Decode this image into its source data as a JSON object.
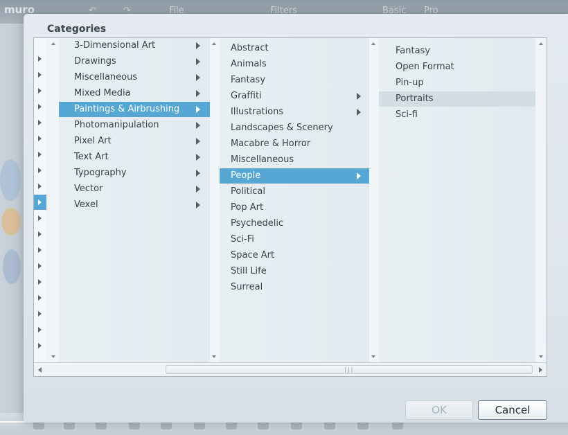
{
  "app": {
    "logo": "muro",
    "toolbar": [
      "File",
      "Filters",
      "Basic",
      "Pro"
    ]
  },
  "dialog": {
    "title": "Categories",
    "ok_label": "OK",
    "cancel_label": "Cancel"
  },
  "columns": {
    "col1": [
      {
        "label": "3-Dimensional Art",
        "has_children": true
      },
      {
        "label": "Drawings",
        "has_children": true
      },
      {
        "label": "Miscellaneous",
        "has_children": true
      },
      {
        "label": "Mixed Media",
        "has_children": true
      },
      {
        "label": "Paintings & Airbrushing",
        "has_children": true,
        "selected": true
      },
      {
        "label": "Photomanipulation",
        "has_children": true
      },
      {
        "label": "Pixel Art",
        "has_children": true
      },
      {
        "label": "Text Art",
        "has_children": true
      },
      {
        "label": "Typography",
        "has_children": true
      },
      {
        "label": "Vector",
        "has_children": true
      },
      {
        "label": "Vexel",
        "has_children": true
      }
    ],
    "col2": [
      {
        "label": "Abstract",
        "has_children": false
      },
      {
        "label": "Animals",
        "has_children": false
      },
      {
        "label": "Fantasy",
        "has_children": false
      },
      {
        "label": "Graffiti",
        "has_children": true
      },
      {
        "label": "Illustrations",
        "has_children": true
      },
      {
        "label": "Landscapes & Scenery",
        "has_children": false
      },
      {
        "label": "Macabre & Horror",
        "has_children": false
      },
      {
        "label": "Miscellaneous",
        "has_children": false
      },
      {
        "label": "People",
        "has_children": true,
        "selected": true
      },
      {
        "label": "Political",
        "has_children": false
      },
      {
        "label": "Pop Art",
        "has_children": false
      },
      {
        "label": "Psychedelic",
        "has_children": false
      },
      {
        "label": "Sci-Fi",
        "has_children": false
      },
      {
        "label": "Space Art",
        "has_children": false
      },
      {
        "label": "Still Life",
        "has_children": false
      },
      {
        "label": "Surreal",
        "has_children": false
      }
    ],
    "col3": [
      {
        "label": "Fantasy"
      },
      {
        "label": "Open Format"
      },
      {
        "label": "Pin-up"
      },
      {
        "label": "Portraits",
        "hovered": true
      },
      {
        "label": "Sci-fi"
      }
    ]
  },
  "colors": {
    "selection": "#57a7d4",
    "hover": "#d3dde4"
  }
}
